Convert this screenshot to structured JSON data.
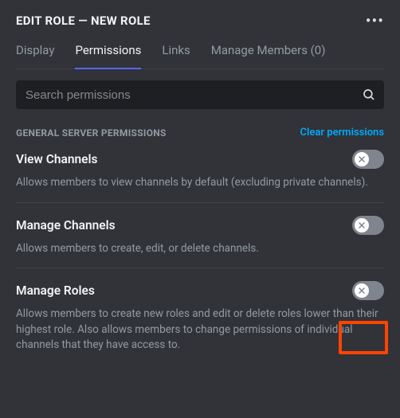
{
  "header": {
    "title": "EDIT ROLE — NEW ROLE"
  },
  "tabs": {
    "display": "Display",
    "permissions": "Permissions",
    "links": "Links",
    "manage_members": "Manage Members (0)"
  },
  "search": {
    "placeholder": "Search permissions"
  },
  "section": {
    "label": "GENERAL SERVER PERMISSIONS",
    "clear": "Clear permissions"
  },
  "perms": {
    "view_channels": {
      "title": "View Channels",
      "desc": "Allows members to view channels by default (excluding private channels)."
    },
    "manage_channels": {
      "title": "Manage Channels",
      "desc": "Allows members to create, edit, or delete channels."
    },
    "manage_roles": {
      "title": "Manage Roles",
      "desc": "Allows members to create new roles and edit or delete roles lower than their highest role. Also allows members to change permissions of individual channels that they have access to."
    }
  }
}
